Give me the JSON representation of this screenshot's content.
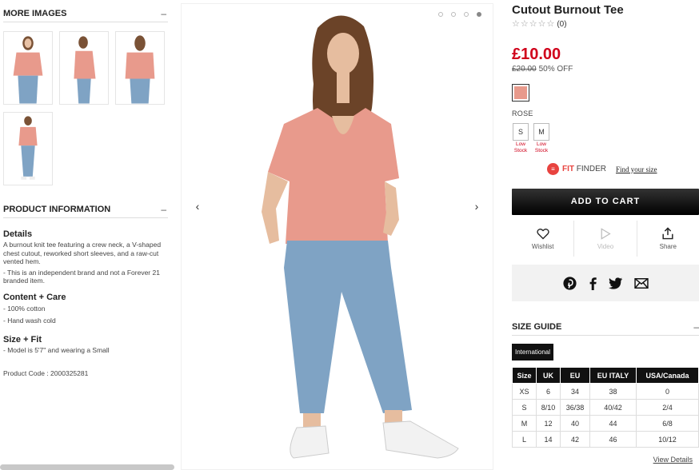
{
  "left": {
    "more_images_title": "MORE IMAGES",
    "collapse_symbol": "–",
    "product_info_title": "PRODUCT INFORMATION",
    "details_title": "Details",
    "details_text": "A burnout knit tee featuring a crew neck, a V-shaped chest cutout, reworked short sleeves, and a raw-cut vented hem.",
    "details_note": "- This is an independent brand and not a Forever 21 branded item.",
    "content_title": "Content + Care",
    "content_items": [
      "- 100% cotton",
      "- Hand wash cold"
    ],
    "size_fit_title": "Size + Fit",
    "size_fit_text": "- Model is 5'7\" and wearing a Small",
    "product_code": "Product Code : 2000325281"
  },
  "gallery": {
    "prev_arrow": "‹",
    "next_arrow": "›",
    "active_dot": 4,
    "dot_count": 4
  },
  "product": {
    "title": "Cutout Burnout Tee",
    "stars": "☆☆☆☆☆",
    "review_count": "(0)",
    "price": "£10.00",
    "old_price": "£20.00",
    "discount": "50% OFF",
    "color_name": "ROSE",
    "swatch_color": "#e89a8c",
    "sizes": [
      {
        "label": "S",
        "stock": "Low Stock"
      },
      {
        "label": "M",
        "stock": "Low Stock"
      }
    ],
    "fit_finder_a": "FIT",
    "fit_finder_b": " FINDER",
    "fit_link": "Find your size",
    "add_to_cart": "ADD TO CART",
    "actions": [
      {
        "label": "Wishlist",
        "icon": "heart-icon"
      },
      {
        "label": "Video",
        "icon": "play-icon"
      },
      {
        "label": "Share",
        "icon": "share-icon"
      }
    ]
  },
  "size_guide": {
    "title": "SIZE GUIDE",
    "collapse_symbol": "–",
    "tab": "International",
    "headers": [
      "Size",
      "UK",
      "EU",
      "EU ITALY",
      "USA/Canada"
    ],
    "rows": [
      [
        "XS",
        "6",
        "34",
        "38",
        "0"
      ],
      [
        "S",
        "8/10",
        "36/38",
        "40/42",
        "2/4"
      ],
      [
        "M",
        "12",
        "40",
        "44",
        "6/8"
      ],
      [
        "L",
        "14",
        "42",
        "46",
        "10/12"
      ]
    ],
    "view_details": "View Details"
  },
  "colors": {
    "accent": "#d0021b",
    "tee": "#e89a8c",
    "jeans": "#7fa3c4"
  }
}
